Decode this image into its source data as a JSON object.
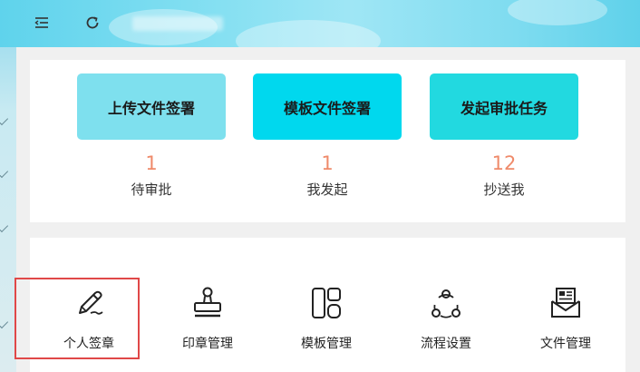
{
  "quick_actions": [
    {
      "label": "上传文件签署",
      "count": "1",
      "caption": "待审批",
      "color": "#7ee0ee"
    },
    {
      "label": "模板文件签署",
      "count": "1",
      "caption": "我发起",
      "color": "#00d8ee"
    },
    {
      "label": "发起审批任务",
      "count": "12",
      "caption": "抄送我",
      "color": "#22d9e0"
    }
  ],
  "modules": [
    {
      "label": "个人签章",
      "icon": "pen-icon"
    },
    {
      "label": "印章管理",
      "icon": "stamp-icon"
    },
    {
      "label": "模板管理",
      "icon": "template-grid-icon"
    },
    {
      "label": "流程设置",
      "icon": "share-nodes-icon"
    },
    {
      "label": "文件管理",
      "icon": "mail-document-icon"
    }
  ],
  "colors": {
    "accent_count": "#ef8a6a",
    "highlight_border": "#e04848"
  }
}
